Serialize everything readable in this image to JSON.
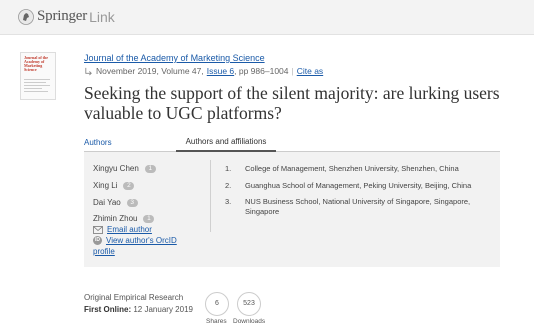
{
  "header": {
    "brand_springer": "Springer",
    "brand_link": "Link"
  },
  "article": {
    "journal": "Journal of the Academy of Marketing Science",
    "issue_date": "November 2019, Volume 47,",
    "issue_link": "Issue 6",
    "pages": ", pp 986–1004",
    "cite_as": "Cite as",
    "title": "Seeking the support of the silent majority: are lurking users valuable to UGC platforms?",
    "cover_title": "Journal of the Academy of Marketing Science"
  },
  "tabs": [
    {
      "label": "Authors"
    },
    {
      "label": "Authors and affiliations"
    }
  ],
  "authors": [
    {
      "name": "Xingyu Chen",
      "badge": "1"
    },
    {
      "name": "Xing Li",
      "badge": "2"
    },
    {
      "name": "Dai Yao",
      "badge": "3"
    },
    {
      "name": "Zhimin Zhou",
      "badge": "1"
    }
  ],
  "author_links": {
    "email": "Email author",
    "orcid": "View author's OrcID",
    "orcid_cont": "profile",
    "orcid_icon_text": "iD"
  },
  "affiliations": [
    {
      "num": "1.",
      "text": "College of Management, Shenzhen University, Shenzhen, China"
    },
    {
      "num": "2.",
      "text": "Guanghua School of Management, Peking University, Beijing, China"
    },
    {
      "num": "3.",
      "text": "NUS Business School, National University of Singapore, Singapore, Singapore"
    }
  ],
  "footer": {
    "article_type": "Original Empirical Research",
    "first_online_label": "First Online:",
    "first_online_date": "12 January 2019",
    "shares_value": "6",
    "shares_label": "Shares",
    "downloads_value": "523",
    "downloads_label": "Downloads"
  },
  "colors": {
    "link": "#1a5aa8",
    "header_bg": "#f3f3f3",
    "panel_bg": "#f2f2f2"
  }
}
